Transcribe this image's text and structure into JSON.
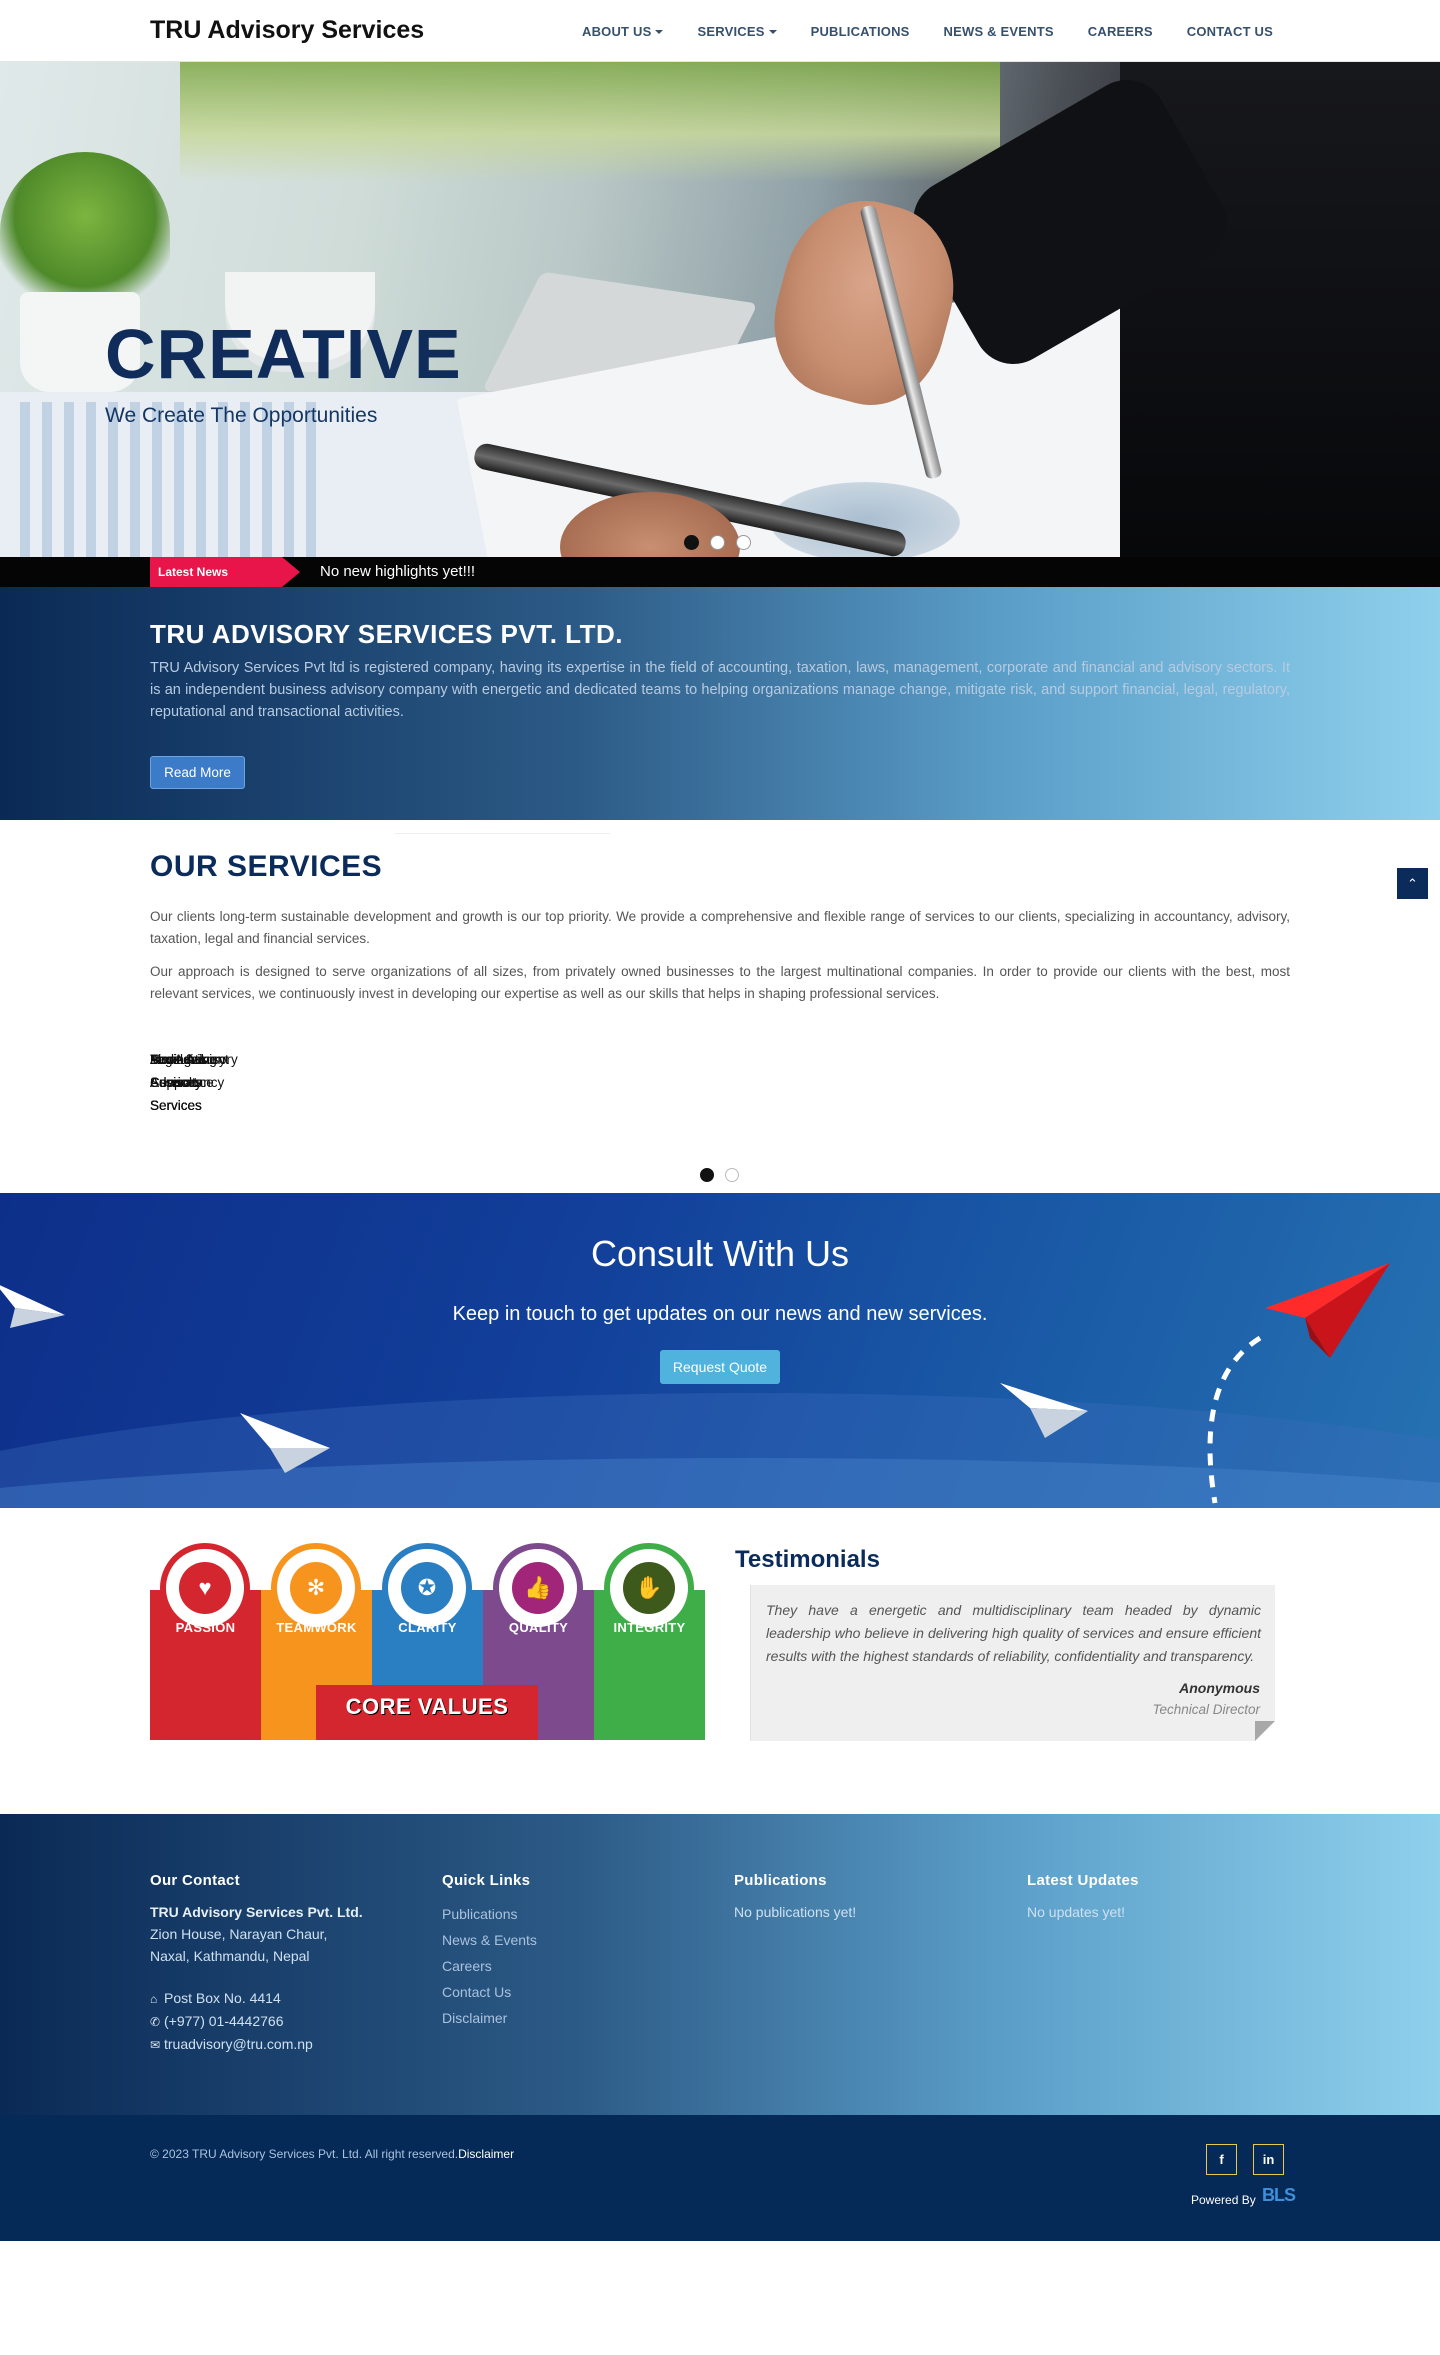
{
  "nav": {
    "brand": "TRU Advisory Services",
    "items": [
      {
        "label": "ABOUT US",
        "dropdown": true
      },
      {
        "label": "SERVICES",
        "dropdown": true
      },
      {
        "label": "PUBLICATIONS",
        "dropdown": false
      },
      {
        "label": "NEWS & EVENTS",
        "dropdown": false
      },
      {
        "label": "CAREERS",
        "dropdown": false
      },
      {
        "label": "CONTACT US",
        "dropdown": false
      }
    ]
  },
  "hero": {
    "title": "CREATIVE",
    "subtitle": "We Create The Opportunities",
    "slide_count": 3,
    "active_slide": 0
  },
  "news": {
    "label": "Latest News",
    "text": "No new highlights yet!!!"
  },
  "about": {
    "title": "TRU ADVISORY SERVICES PVT. LTD.",
    "text": "TRU Advisory Services Pvt ltd is registered company, having its expertise in the field of accounting, taxation, laws, management, corporate and financial and advisory sectors. It is an independent business advisory company with energetic and dedicated teams to helping organizations manage change, mitigate risk, and support financial, legal, regulatory, reputational and transactional activities.",
    "button": "Read More"
  },
  "services": {
    "title": "OUR SERVICES",
    "p1": "Our clients long-term sustainable development and growth is our top priority. We provide a comprehensive and flexible range of services to our clients, specializing in accountancy, advisory, taxation, legal and financial services.",
    "p2": "Our approach is designed to serve organizations of all sizes, from privately owned businesses to the largest multinational companies. In order to provide our clients with the best, most relevant services, we continuously invest in developing our expertise as well as our skills that helps in shaping professional services.",
    "overlap_items": [
      "Management Consultancy Services",
      "Tax Advisory Services",
      "Legal Advisory Services",
      "Financial Advisory Services",
      "Audit & Assurance Services",
      "Accounting Support Services",
      "Business Advisory Services"
    ],
    "slide_count": 2,
    "active_slide": 0,
    "scroll_top_icon": "chevron-up-icon"
  },
  "consult": {
    "title": "Consult With Us",
    "subtitle": "Keep in touch to get updates on our news and new services.",
    "button": "Request Quote"
  },
  "values": {
    "items": [
      {
        "label": "PASSION",
        "color": "#d4262e",
        "icon": "heart-icon",
        "glyph": "♥"
      },
      {
        "label": "TEAMWORK",
        "color": "#f7941d",
        "icon": "teamwork-icon",
        "glyph": "✻"
      },
      {
        "label": "CLARITY",
        "color": "#2a7ec2",
        "icon": "bulb-icon",
        "glyph": "✪"
      },
      {
        "label": "QUALITY",
        "color": "#7d4a8e",
        "icon": "thumbs-up-icon",
        "glyph": "👍"
      },
      {
        "label": "INTEGRITY",
        "color": "#3fae49",
        "icon": "handshake-icon",
        "glyph": "✋"
      }
    ],
    "banner": "CORE VALUES"
  },
  "testimonials": {
    "title": "Testimonials",
    "quote": "They have a energetic and multidisciplinary team headed by dynamic leadership who believe in delivering high quality of services and ensure efficient results with the highest standards of reliability, confidentiality and transparency.",
    "author": "Anonymous",
    "role": "Technical Director"
  },
  "footer": {
    "contact": {
      "title": "Our Contact",
      "company": "TRU Advisory Services Pvt. Ltd.",
      "address1": "Zion House, Narayan Chaur,",
      "address2": "Naxal, Kathmandu, Nepal",
      "pobox": "Post Box No. 4414",
      "phone": "(+977) 01-4442766",
      "email": "truadvisory@tru.com.np"
    },
    "quicklinks": {
      "title": "Quick Links",
      "items": [
        "Publications",
        "News & Events",
        "Careers",
        "Contact Us",
        "Disclaimer"
      ]
    },
    "publications": {
      "title": "Publications",
      "text": "No publications yet!"
    },
    "updates": {
      "title": "Latest Updates",
      "text": "No updates yet!"
    }
  },
  "bottom": {
    "copyright": "© 2023 TRU Advisory Services Pvt. Ltd. All right reserved.",
    "disclaimer": "Disclaimer",
    "social": [
      {
        "icon": "facebook-icon",
        "glyph": "f"
      },
      {
        "icon": "linkedin-icon",
        "glyph": "in"
      }
    ],
    "powered_by": "Powered By",
    "powered_logo": "BLS"
  }
}
